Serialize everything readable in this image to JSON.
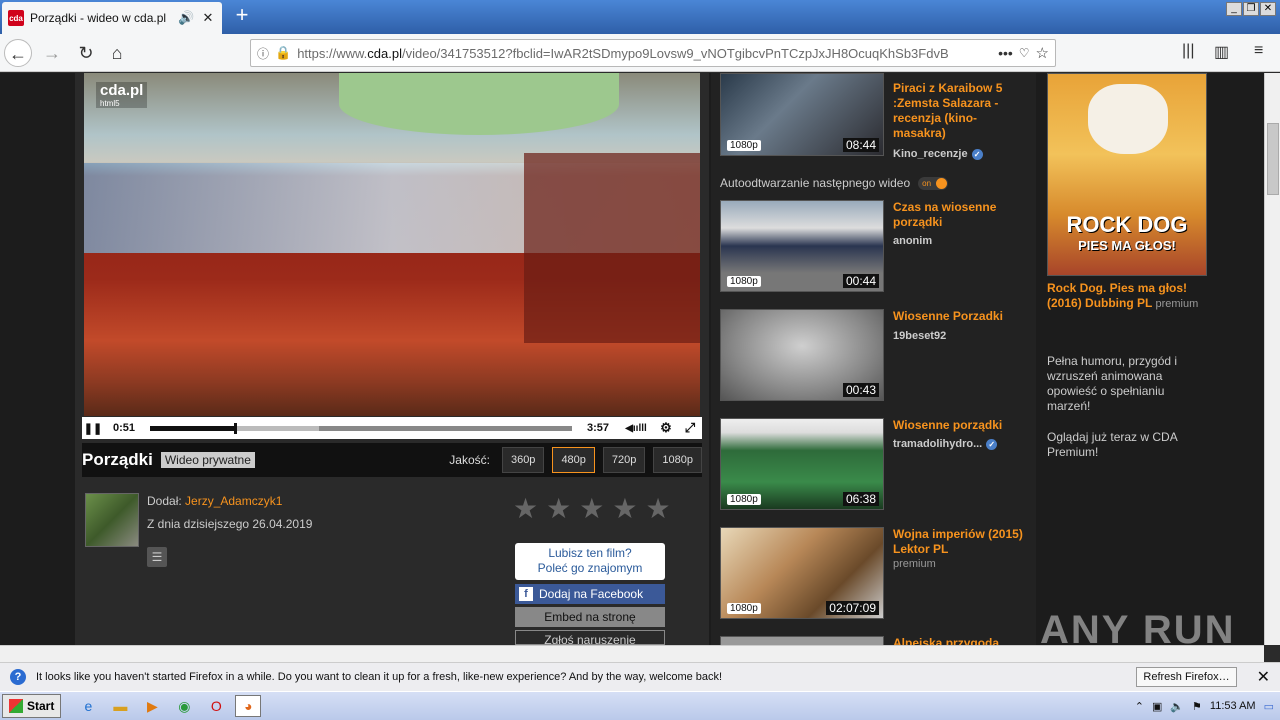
{
  "browser": {
    "tab_title": "Porządki - wideo w cda.pl",
    "favicon_text": "cda",
    "url_prefix": "https://www.",
    "url_domain": "cda.pl",
    "url_rest": "/video/341753512?fbclid=IwAR2tSDmypo9Lovsw9_vNOTgibcvPnTCzpJxJH8OcuqKhSb3FdvB",
    "window_controls": [
      "_",
      "❐",
      "✕"
    ]
  },
  "player": {
    "logo": "cda.pl",
    "logo_sub": "html5",
    "current_time": "0:51",
    "total_time": "3:57",
    "progress": 0.2,
    "buffered": 0.4
  },
  "video": {
    "title": "Porządki",
    "private_label": "Wideo prywatne",
    "quality_label": "Jakość:",
    "qualities": [
      "360p",
      "480p",
      "720p",
      "1080p"
    ],
    "selected_quality": "480p"
  },
  "uploader": {
    "added_by_label": "Dodał:",
    "added_by_name": "Jerzy_Adamczyk1",
    "date_text": "Z dnia dzisiejszego 26.04.2019"
  },
  "share": {
    "bubble_line1": "Lubisz ten film?",
    "bubble_line2": "Poleć go znajomym",
    "facebook_label": "Dodaj na Facebook",
    "embed_label": "Embed na stronę",
    "report_label": "Zgłoś naruszenie"
  },
  "sidebar": {
    "autoplay_label": "Autoodtwarzanie następnego wideo",
    "autoplay_state": "on",
    "videos": [
      {
        "title": "Piraci z Karaibow 5 :Zemsta Salazara - recenzja (kino-masakra)",
        "author": "Kino_recenzje",
        "verified": true,
        "badge": "1080p",
        "duration": "08:44"
      },
      {
        "title": "Czas na wiosenne porządki",
        "author": "anonim",
        "verified": false,
        "badge": "1080p",
        "duration": "00:44"
      },
      {
        "title": "Wiosenne Porzadki",
        "author": "19beset92",
        "verified": false,
        "badge": "",
        "duration": "00:43"
      },
      {
        "title": "Wiosenne porządki",
        "author": "tramadolihydro...",
        "verified": true,
        "badge": "1080p",
        "duration": "06:38"
      },
      {
        "title": "Wojna imperiów (2015) Lektor PL",
        "author": "premium",
        "verified": false,
        "badge": "1080p",
        "duration": "02:07:09"
      },
      {
        "title": "Alpejska przygoda",
        "author": "",
        "verified": false,
        "badge": "",
        "duration": ""
      }
    ]
  },
  "ad": {
    "poster_title": "ROCK DOG",
    "poster_sub": "PIES MA GŁOS!",
    "title": "Rock Dog. Pies ma głos! (2016) Dubbing PL",
    "title_tag": "premium",
    "description": "Pełna humoru, przygód i wzruszeń animowana opowieść o spełnianiu marzeń!",
    "cta": "Oglądaj już teraz w CDA Premium!"
  },
  "notification": {
    "text": "It looks like you haven't started Firefox in a while. Do you want to clean it up for a fresh, like-new experience? And by the way, welcome back!",
    "button": "Refresh Firefox…"
  },
  "taskbar": {
    "start_label": "Start",
    "clock": "11:53 AM"
  },
  "watermark": "ANY RUN",
  "colors": {
    "accent": "#f7931e",
    "facebook": "#3b5998"
  }
}
